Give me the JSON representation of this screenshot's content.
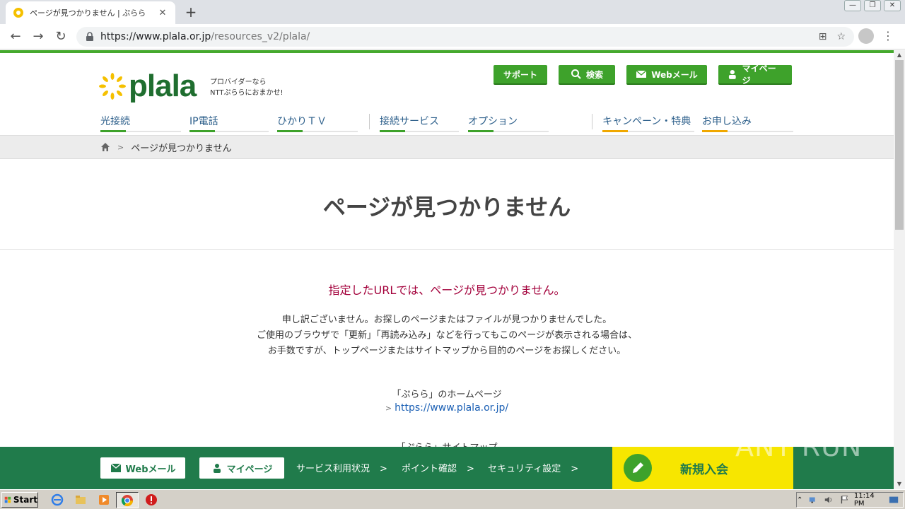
{
  "browser": {
    "tab_title": "ページが見つかりません | ぷらら",
    "tab_close": "✕",
    "newtab": "+",
    "url_host": "https://www.plala.or.jp",
    "url_path": "/resources_v2/plala/",
    "back": "←",
    "forward": "→",
    "reload": "↻",
    "translate": "⊞",
    "bookmark": "☆",
    "menu": "⋮",
    "win_min": "—",
    "win_max": "❐",
    "win_close": "✕"
  },
  "header": {
    "logo_text": "plala",
    "tagline_1": "プロバイダーなら",
    "tagline_2": "NTTぷららにおまかせ!",
    "buttons": {
      "support": "サポート",
      "search": "検索",
      "webmail": "Webメール",
      "mypage": "マイページ"
    }
  },
  "gnav": {
    "items": [
      {
        "label": "光接続",
        "color": "#3ea22b"
      },
      {
        "label": "IP電話",
        "color": "#3ea22b"
      },
      {
        "label": "ひかりＴＶ",
        "color": "#3ea22b"
      },
      {
        "label": "接続サービス",
        "color": "#3ea22b"
      },
      {
        "label": "オプション",
        "color": "#3ea22b"
      },
      {
        "label": "キャンペーン・特典",
        "color": "#f0a800"
      },
      {
        "label": "お申し込み",
        "color": "#f0a800"
      }
    ]
  },
  "breadcrumb": {
    "sep": ">",
    "current": "ページが見つかりません"
  },
  "main": {
    "title": "ページが見つかりません",
    "error_heading": "指定したURLでは、ページが見つかりません。",
    "message_1": "申し訳ございません。お探しのページまたはファイルが見つかりませんでした。",
    "message_2": "ご使用のブラウザで「更新」「再読み込み」などを行ってもこのページが表示される場合は、",
    "message_3": "お手数ですが、トップページまたはサイトマップから目的のページをお探しください。",
    "home_label": "「ぷらら」のホームページ",
    "home_chev": ">",
    "home_url": "https://www.plala.or.jp/",
    "sitemap_label": "「ぷらら」サイトマップ"
  },
  "footer": {
    "webmail": "Webメール",
    "mypage": "マイページ",
    "links": [
      "サービス利用状況",
      "ポイント確認",
      "セキュリティ設定"
    ],
    "chev": ">",
    "join": "新規入会"
  },
  "watermark": "ANY RUN",
  "taskbar": {
    "start": "Start",
    "tray_up": "⌃",
    "time": "11:14 PM"
  },
  "colors": {
    "brand_green": "#3ea22b",
    "dark_green": "#207b4b",
    "error_red": "#a3003b",
    "link_blue": "#1a5fb4",
    "join_yellow": "#f7e600"
  }
}
